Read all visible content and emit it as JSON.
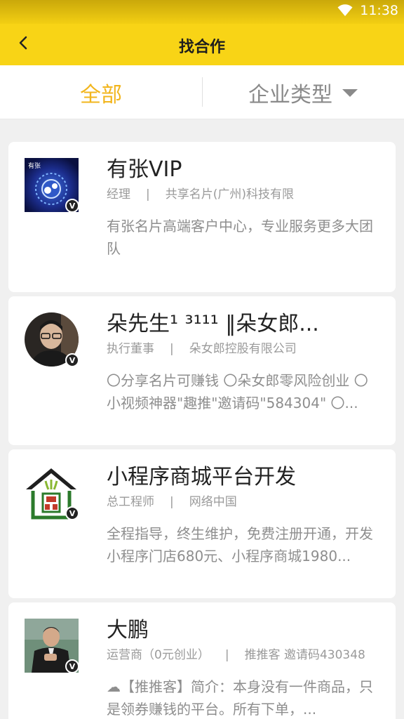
{
  "status": {
    "time": "11:38"
  },
  "header": {
    "title": "找合作"
  },
  "tabs": {
    "all": "全部",
    "type": "企业类型"
  },
  "badge": "V",
  "contacts": [
    {
      "name": "有张VIP",
      "position": "经理",
      "company": "共享名片(广州)科技有限",
      "description": "有张名片高端客户中心，专业服务更多大团队",
      "avatar_text": "有张"
    },
    {
      "name": "朵先生¹ ³¹¹¹ ‖朵女郎...",
      "position": "执行董事",
      "company": "朵女郎控股有限公司",
      "description": "〇分享名片可赚钱 〇朵女郎零风险创业 〇小视频神器\"趣推\"邀请码\"584304\" 〇..."
    },
    {
      "name": "小程序商城平台开发",
      "position": "总工程师",
      "company": "网络中国",
      "description": "全程指导，终生维护，免费注册开通，开发小程序门店680元、小程序商城1980..."
    },
    {
      "name": "大鹏",
      "position": "运营商（0元创业）",
      "company": "推推客 邀请码430348",
      "description": "☁【推推客】简介：本身没有一件商品，只是领券赚钱的平台。所有下单，..."
    }
  ]
}
